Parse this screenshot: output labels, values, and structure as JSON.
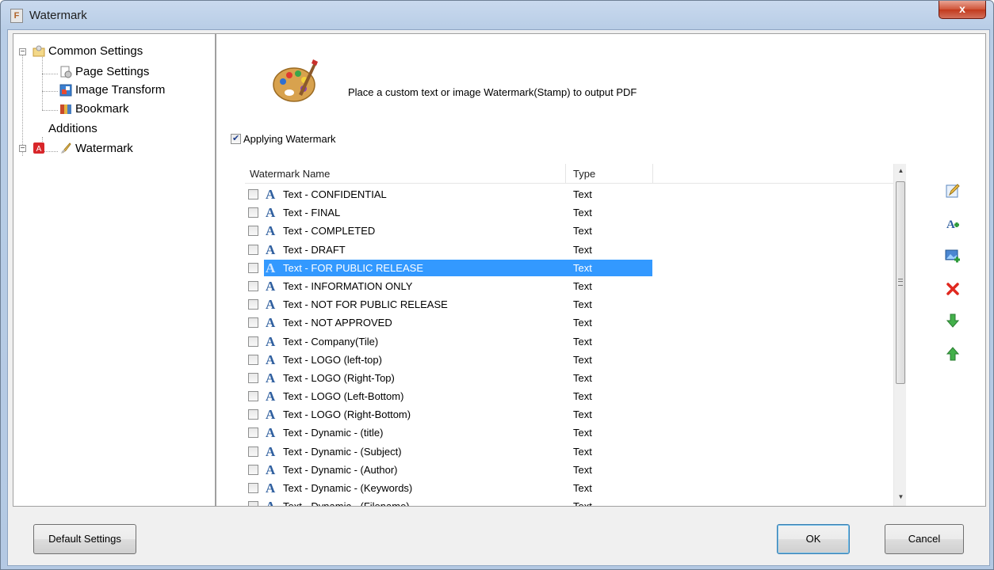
{
  "window": {
    "title": "Watermark",
    "app_icon_letter": "F",
    "close_glyph": "x"
  },
  "tree": {
    "items": [
      {
        "label": "Common Settings",
        "icon": "settings-folder-icon",
        "expanded": true
      },
      {
        "label": "Page Settings",
        "icon": "page-settings-icon"
      },
      {
        "label": "Image Transform",
        "icon": "image-transform-icon"
      },
      {
        "label": "Bookmark",
        "icon": "bookmark-icon"
      },
      {
        "label": "Additions",
        "icon": "pdf-additions-icon",
        "expanded": true
      },
      {
        "label": "Watermark",
        "icon": "brush-icon"
      }
    ]
  },
  "panel": {
    "description": "Place a custom text or image Watermark(Stamp) to output PDF",
    "apply_label": "Applying Watermark",
    "apply_checked": true,
    "columns": {
      "name": "Watermark Name",
      "type": "Type"
    },
    "rows": [
      {
        "name": "Text - CONFIDENTIAL",
        "type": "Text"
      },
      {
        "name": "Text - FINAL",
        "type": "Text"
      },
      {
        "name": "Text - COMPLETED",
        "type": "Text"
      },
      {
        "name": "Text - DRAFT",
        "type": "Text"
      },
      {
        "name": "Text - FOR PUBLIC RELEASE",
        "type": "Text",
        "selected": true
      },
      {
        "name": "Text - INFORMATION ONLY",
        "type": "Text"
      },
      {
        "name": "Text - NOT FOR PUBLIC RELEASE",
        "type": "Text"
      },
      {
        "name": "Text - NOT APPROVED",
        "type": "Text"
      },
      {
        "name": "Text - Company(Tile)",
        "type": "Text"
      },
      {
        "name": "Text - LOGO (left-top)",
        "type": "Text"
      },
      {
        "name": "Text - LOGO (Right-Top)",
        "type": "Text"
      },
      {
        "name": "Text - LOGO (Left-Bottom)",
        "type": "Text"
      },
      {
        "name": "Text - LOGO (Right-Bottom)",
        "type": "Text"
      },
      {
        "name": "Text - Dynamic - (title)",
        "type": "Text"
      },
      {
        "name": "Text - Dynamic - (Subject)",
        "type": "Text"
      },
      {
        "name": "Text - Dynamic - (Author)",
        "type": "Text"
      },
      {
        "name": "Text - Dynamic - (Keywords)",
        "type": "Text"
      },
      {
        "name": "Text - Dynamic - (Filename)",
        "type": "Text"
      }
    ],
    "side_tools": [
      {
        "name": "edit-watermark-icon",
        "glyph": "✎"
      },
      {
        "name": "add-text-watermark-icon",
        "glyph": "A+"
      },
      {
        "name": "add-image-watermark-icon",
        "glyph": "▣"
      },
      {
        "name": "delete-watermark-icon",
        "glyph": "✖"
      },
      {
        "name": "move-down-icon",
        "glyph": "⬇"
      },
      {
        "name": "move-up-icon",
        "glyph": "⬆"
      }
    ]
  },
  "buttons": {
    "default_settings": "Default Settings",
    "ok": "OK",
    "cancel": "Cancel"
  },
  "colors": {
    "selection": "#3399ff",
    "window_frame": "#b8cde6",
    "close_button": "#c2391c"
  }
}
